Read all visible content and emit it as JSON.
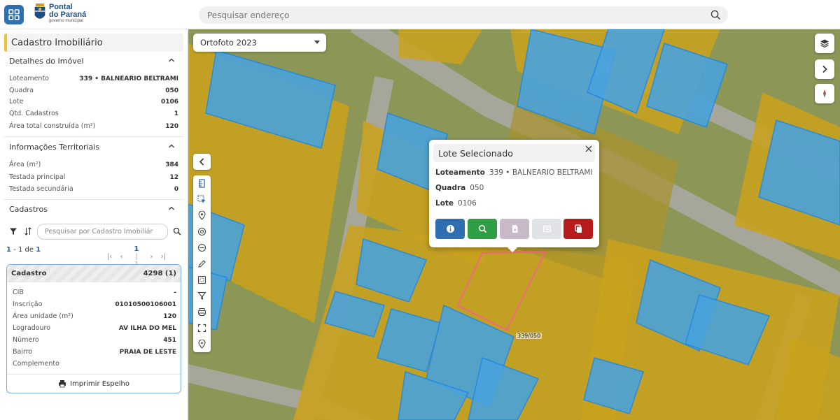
{
  "header": {
    "logo_line1": "Pontal",
    "logo_line2": "do Paraná",
    "logo_line3": "governo municipal",
    "search_placeholder": "Pesquisar endereço"
  },
  "sidebar": {
    "title": "Cadastro Imobiliário",
    "details": {
      "heading": "Detalhes do Imóvel",
      "rows": [
        {
          "label": "Loteamento",
          "value": "339 • BALNEARIO BELTRAMI"
        },
        {
          "label": "Quadra",
          "value": "050"
        },
        {
          "label": "Lote",
          "value": "0106"
        },
        {
          "label": "Qtd. Cadastros",
          "value": "1"
        },
        {
          "label": "Área total construída (m²)",
          "value": "120"
        }
      ]
    },
    "territorial": {
      "heading": "Informações Territoriais",
      "rows": [
        {
          "label": "Área (m²)",
          "value": "384"
        },
        {
          "label": "Testada principal",
          "value": "12"
        },
        {
          "label": "Testada secundária",
          "value": "0"
        }
      ]
    },
    "cadastros": {
      "heading": "Cadastros",
      "search_placeholder": "Pesquisar por Cadastro Imobiliár",
      "range_start": "1",
      "range_sep": " - ",
      "range_end": "1",
      "range_of": " de ",
      "total": "1",
      "page": "1",
      "page_total": "1",
      "card": {
        "title": "Cadastro",
        "number": "4298 (1)",
        "rows": [
          {
            "label": "CIB",
            "value": "-"
          },
          {
            "label": "Inscrição",
            "value": "01010500106001"
          },
          {
            "label": "Área unidade (m²)",
            "value": "120"
          },
          {
            "label": "Logradouro",
            "value": "AV ILHA DO MEL"
          },
          {
            "label": "Número",
            "value": "451"
          },
          {
            "label": "Bairro",
            "value": "PRAIA DE LESTE"
          },
          {
            "label": "Complemento",
            "value": ""
          }
        ],
        "print_label": "Imprimir Espelho"
      }
    }
  },
  "map": {
    "layer_selected": "Ortofoto 2023",
    "parcel_label": "339/050",
    "popup": {
      "title": "Lote Selecionado",
      "rows": [
        {
          "label": "Loteamento",
          "value": "339 • BALNEARIO BELTRAMI"
        },
        {
          "label": "Quadra",
          "value": "050"
        },
        {
          "label": "Lote",
          "value": "0106"
        }
      ]
    },
    "colors": {
      "lot_fill": "#c9a21c",
      "building_fill": "#4aa3dc",
      "road": "#a6a69a",
      "selected_outline": "#f06a7c"
    }
  }
}
